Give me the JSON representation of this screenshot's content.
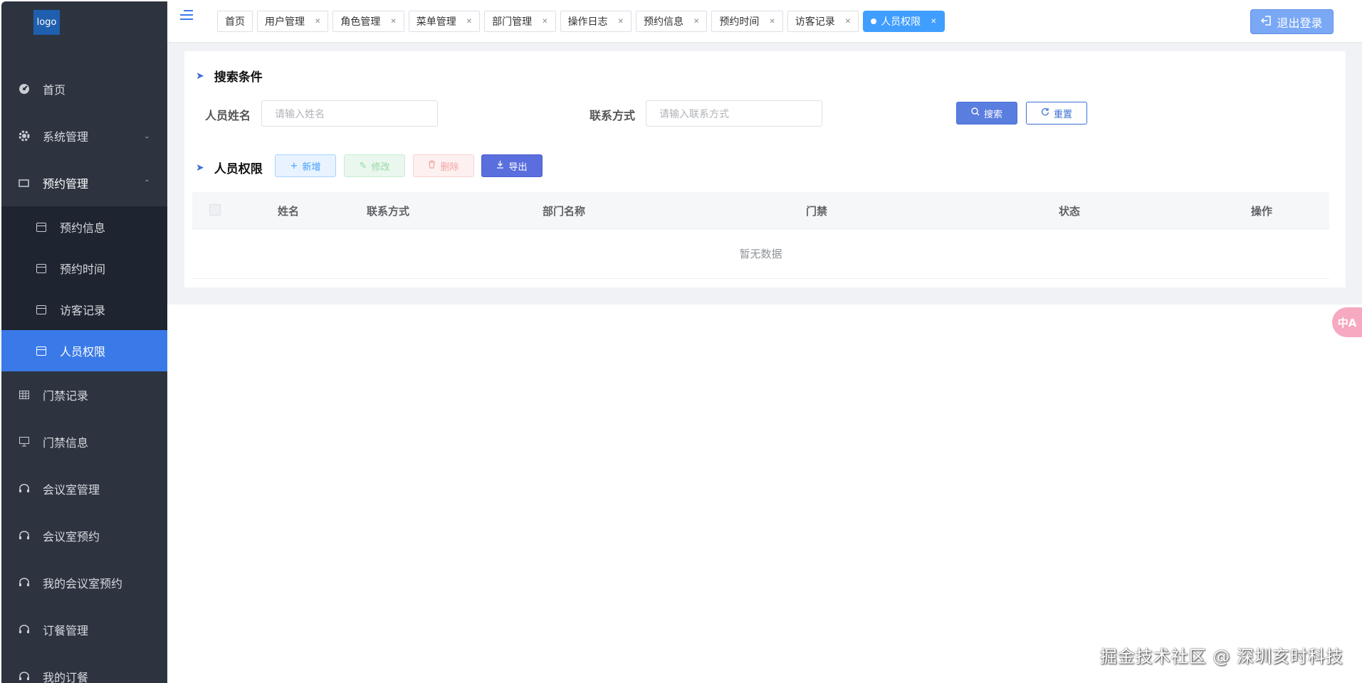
{
  "logo": {
    "text": "logo"
  },
  "sidebar": {
    "items": [
      {
        "label": "首页",
        "icon": "dashboard-icon"
      },
      {
        "label": "系统管理",
        "icon": "gear-icon",
        "expanded": false
      },
      {
        "label": "预约管理",
        "icon": "card-icon",
        "expanded": true,
        "children": [
          {
            "label": "预约信息",
            "icon": "calendar-icon"
          },
          {
            "label": "预约时间",
            "icon": "calendar-icon"
          },
          {
            "label": "访客记录",
            "icon": "calendar-icon"
          },
          {
            "label": "人员权限",
            "icon": "calendar-icon",
            "active": true
          }
        ]
      },
      {
        "label": "门禁记录",
        "icon": "table-icon"
      },
      {
        "label": "门禁信息",
        "icon": "monitor-icon"
      },
      {
        "label": "会议室管理",
        "icon": "headset-icon"
      },
      {
        "label": "会议室预约",
        "icon": "headset-icon"
      },
      {
        "label": "我的会议室预约",
        "icon": "headset-icon"
      },
      {
        "label": "订餐管理",
        "icon": "headset-icon"
      },
      {
        "label": "我的订餐",
        "icon": "headset-icon"
      }
    ]
  },
  "header": {
    "tabs": [
      {
        "label": "首页",
        "closable": false
      },
      {
        "label": "用户管理",
        "closable": true
      },
      {
        "label": "角色管理",
        "closable": true
      },
      {
        "label": "菜单管理",
        "closable": true
      },
      {
        "label": "部门管理",
        "closable": true
      },
      {
        "label": "操作日志",
        "closable": true
      },
      {
        "label": "预约信息",
        "closable": true
      },
      {
        "label": "预约时间",
        "closable": true
      },
      {
        "label": "访客记录",
        "closable": true
      },
      {
        "label": "人员权限",
        "closable": true,
        "active": true
      }
    ],
    "logout_label": "退出登录"
  },
  "search": {
    "title": "搜索条件",
    "name_label": "人员姓名",
    "name_placeholder": "请输入姓名",
    "contact_label": "联系方式",
    "contact_placeholder": "请输入联系方式",
    "search_btn": "搜索",
    "reset_btn": "重置"
  },
  "toolbar": {
    "title": "人员权限",
    "add": "新增",
    "edit": "修改",
    "delete": "删除",
    "export": "导出"
  },
  "table": {
    "columns": [
      "姓名",
      "联系方式",
      "部门名称",
      "门禁",
      "状态",
      "操作"
    ],
    "empty_text": "暂无数据"
  },
  "translate": {
    "label": "中A"
  },
  "watermark": "掘金技术社区 @ 深圳亥时科技",
  "colors": {
    "sidebar_bg": "#2d3440",
    "accent": "#3a7ae8",
    "active_tab": "#409eff"
  }
}
